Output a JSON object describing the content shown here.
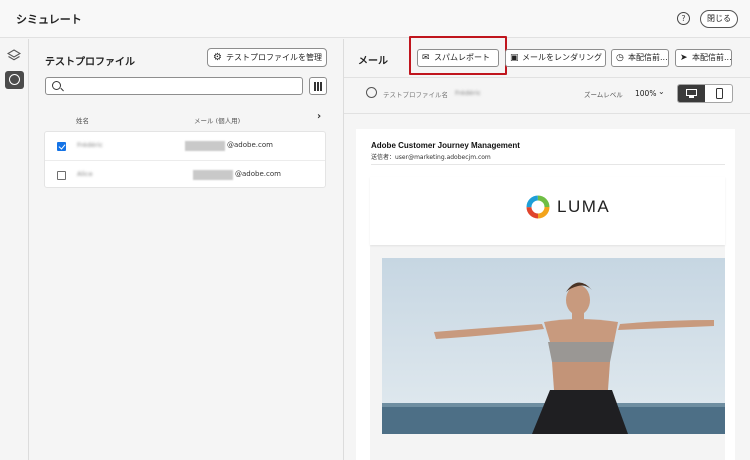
{
  "app": {
    "title": "シミュレート",
    "help_icon": "help-circle-icon",
    "close_label": "閉じる"
  },
  "rail": {
    "items": [
      "layers-icon",
      "user-profile-icon"
    ]
  },
  "left": {
    "title": "テストプロファイル",
    "manage_label": "テストプロファイルを管理",
    "search_placeholder": "",
    "columns": {
      "name": "姓名",
      "email": "メール (個人用)"
    },
    "rows": [
      {
        "checked": true,
        "name": "Frédéric",
        "email_domain": "@adobe.com"
      },
      {
        "checked": false,
        "name": "Alice",
        "email_domain": "@adobe.com"
      }
    ]
  },
  "right": {
    "title": "メール",
    "buttons": {
      "spam": "スパムレポート",
      "render": "メールをレンダリング",
      "proof1": "本配信前...",
      "proof2": "本配信前..."
    },
    "profile_label": "テストプロファイル名",
    "profile_value": "Frédéric",
    "zoom_label": "ズームレベル",
    "zoom_value": "100%",
    "accent_color": "#c0151d"
  },
  "email": {
    "brand": "Adobe Customer Journey Management",
    "sender": "送信者：user@marketing.adobecjm.com",
    "logo_text": "LUMA"
  }
}
